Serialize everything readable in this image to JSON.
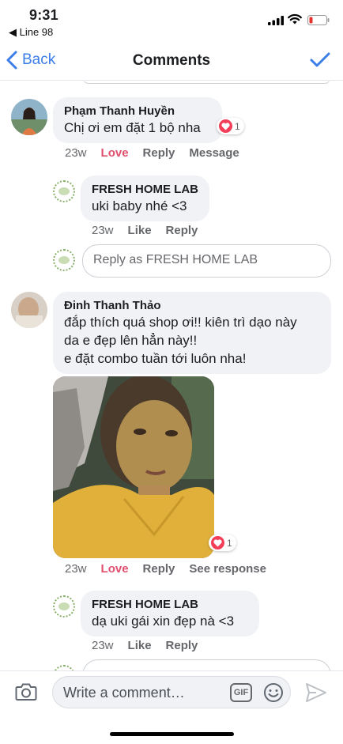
{
  "status_bar": {
    "time": "9:31",
    "back_app": "◀ Line 98"
  },
  "nav": {
    "back_label": "Back",
    "title": "Comments"
  },
  "comments": [
    {
      "author": "Phạm Thanh Huyền",
      "text": "Chị ơi em đặt 1 bộ nha",
      "reaction_count": "1",
      "time": "23w",
      "actions": [
        "Love",
        "Reply",
        "Message"
      ]
    },
    {
      "author": "Đinh Thanh Thảo",
      "text_lines": [
        "đắp thích quá shop ơi!! kiên trì dạo này",
        "da e đẹp lên hẳn này!!",
        "e đặt combo tuần tới luôn nha!"
      ],
      "reaction_count": "1",
      "time": "23w",
      "actions": [
        "Love",
        "Reply",
        "See response"
      ]
    }
  ],
  "replies": [
    {
      "author": "FRESH HOME LAB",
      "text": "uki baby nhé <3",
      "time": "23w",
      "actions": [
        "Like",
        "Reply"
      ]
    },
    {
      "author": "FRESH HOME LAB",
      "text": "dạ uki gái xin đẹp nà <3",
      "time": "23w",
      "actions": [
        "Like",
        "Reply"
      ]
    }
  ],
  "reply_box": {
    "placeholder": "Reply as FRESH HOME LAB"
  },
  "composer": {
    "placeholder": "Write a comment…",
    "gif_label": "GIF"
  },
  "colors": {
    "accent": "#3b7de9",
    "love": "#e0506e",
    "bubble": "#f0f2f5"
  }
}
